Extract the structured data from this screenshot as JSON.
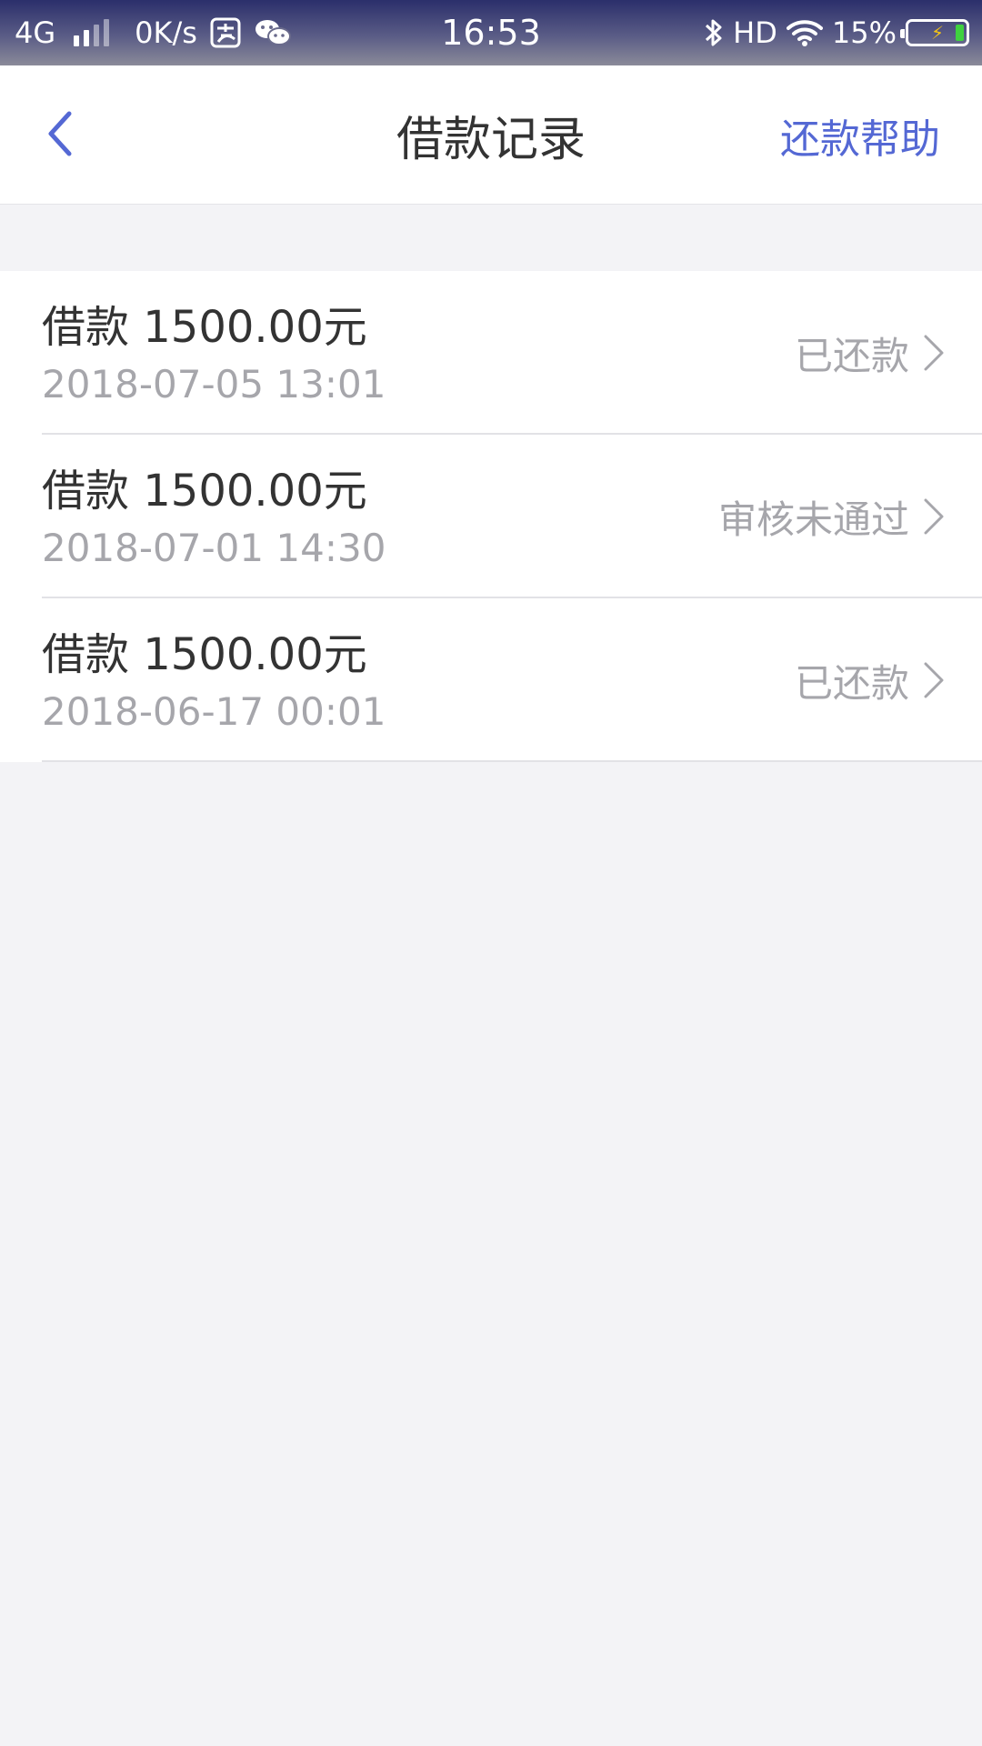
{
  "status_bar": {
    "network": "4G",
    "speed": "0K/s",
    "time": "16:53",
    "hd": "HD",
    "battery_percent_text": "15%",
    "battery_level": 0.15,
    "icons": [
      "signal-icon",
      "alipay-icon",
      "wechat-icon",
      "bluetooth-icon",
      "wifi-icon",
      "battery-icon",
      "charging-bolt-icon"
    ]
  },
  "nav": {
    "title": "借款记录",
    "help_label": "还款帮助",
    "back_icon": "chevron-left-icon",
    "accent_color": "#5468d4"
  },
  "records": [
    {
      "title": "借款 1500.00元",
      "date": "2018-07-05 13:01",
      "status": "已还款"
    },
    {
      "title": "借款 1500.00元",
      "date": "2018-07-01 14:30",
      "status": "审核未通过"
    },
    {
      "title": "借款 1500.00元",
      "date": "2018-06-17 00:01",
      "status": "已还款"
    }
  ],
  "colors": {
    "background": "#f3f3f6",
    "title_text": "#333333",
    "secondary_text": "#a6a6ab"
  }
}
